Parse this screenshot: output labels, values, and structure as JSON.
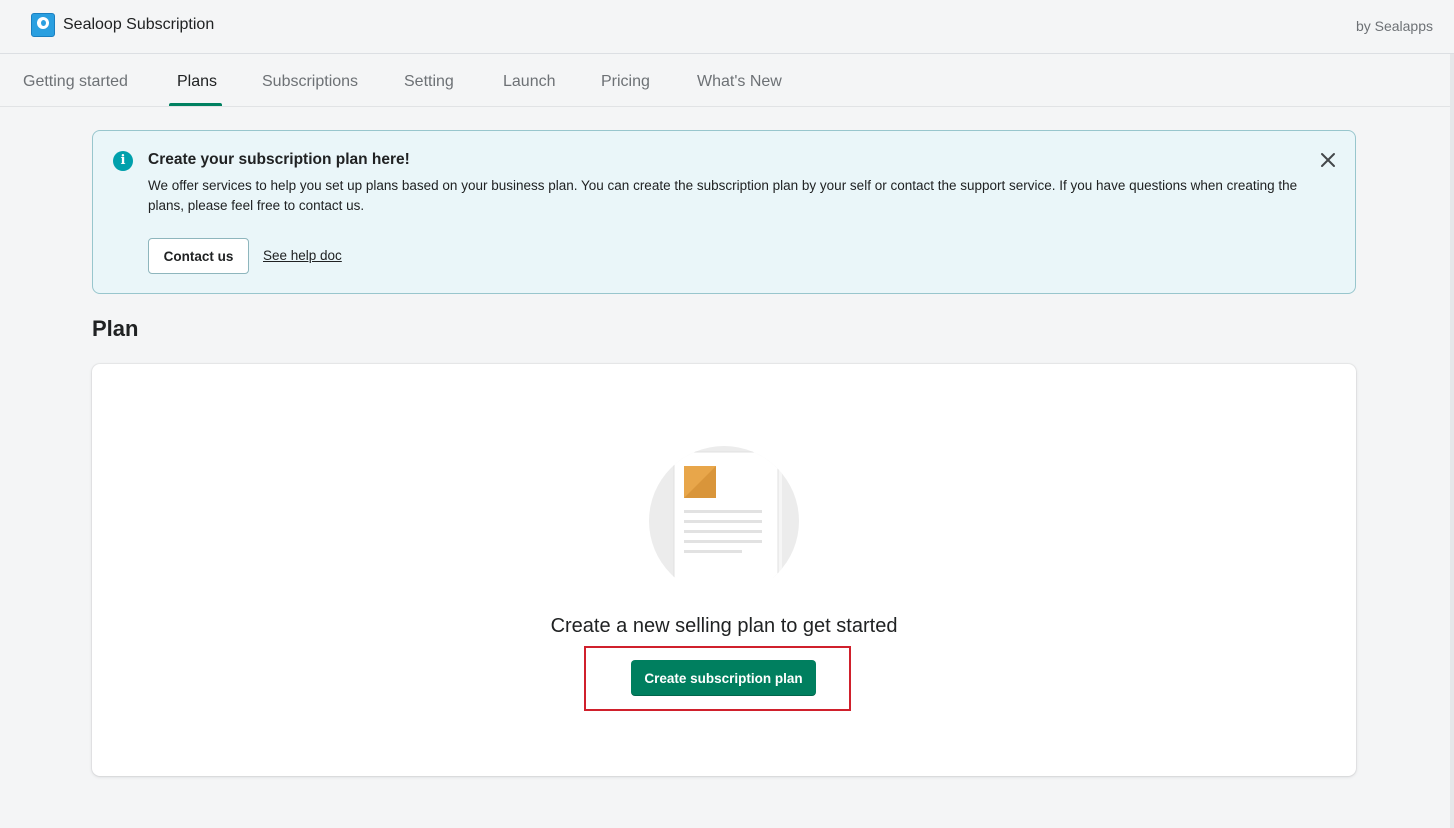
{
  "app": {
    "title": "Sealoop Subscription",
    "by": "by Sealapps",
    "accent_color": "#008060"
  },
  "tabs": [
    {
      "label": "Getting started",
      "active": false
    },
    {
      "label": "Plans",
      "active": true
    },
    {
      "label": "Subscriptions",
      "active": false
    },
    {
      "label": "Setting",
      "active": false
    },
    {
      "label": "Launch",
      "active": false
    },
    {
      "label": "Pricing",
      "active": false
    },
    {
      "label": "What's New",
      "active": false
    }
  ],
  "banner": {
    "icon": "info-icon",
    "title": "Create your subscription plan here!",
    "text": "We offer services to help you set up plans based on your business plan. You can create the subscription plan by your self or contact the support service. If you have questions when creating the plans, please feel free to contact us.",
    "contact_label": "Contact us",
    "help_label": "See help doc",
    "background_color": "#eaf6f9",
    "icon_color": "#00a0ac"
  },
  "plan_section": {
    "title": "Plan",
    "empty_state_text": "Create a new selling plan to get started",
    "create_button_label": "Create subscription plan",
    "button_color": "#007f5f",
    "highlight_color": "#d0202c"
  }
}
